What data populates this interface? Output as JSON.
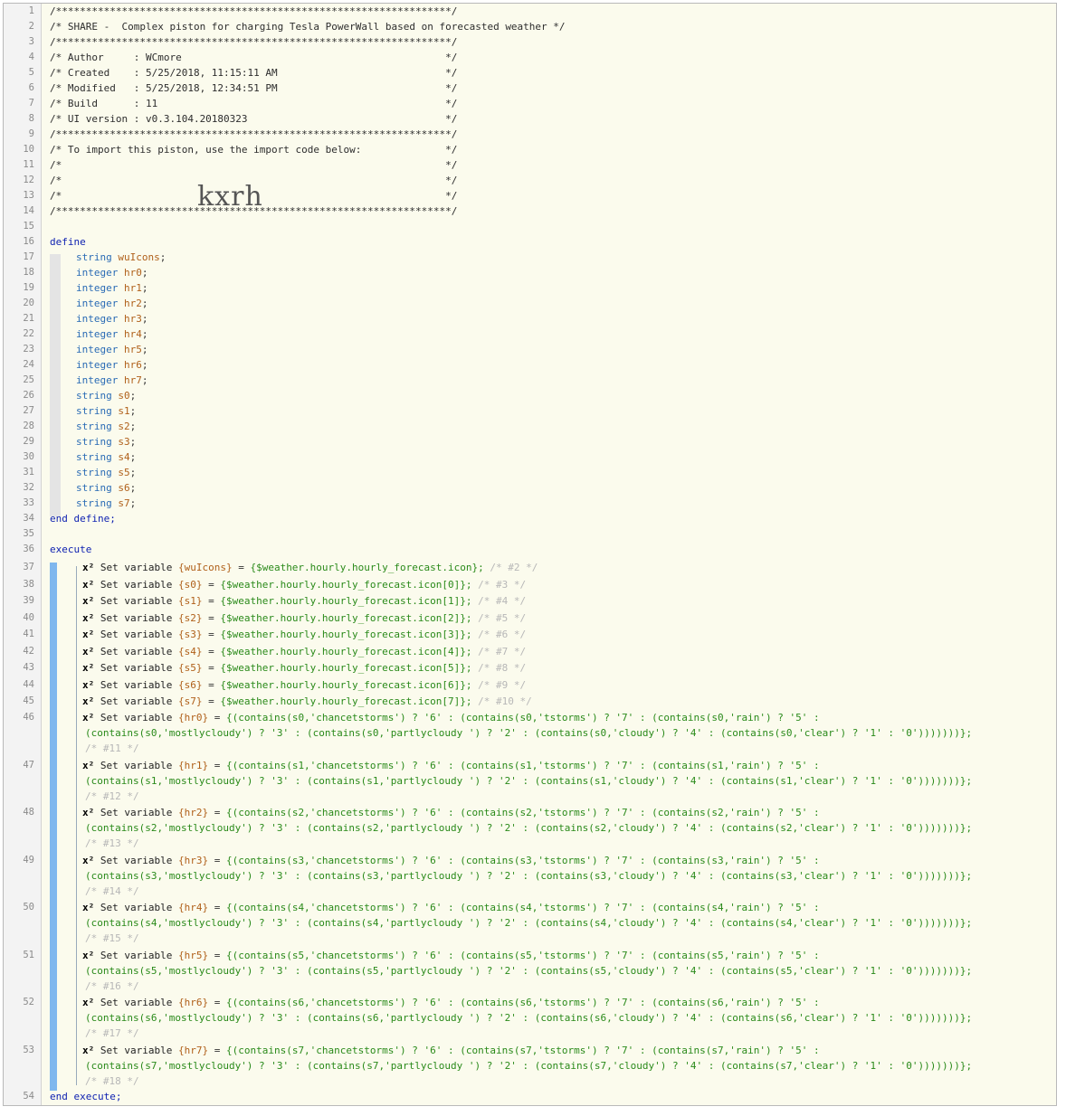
{
  "header": [
    "/******************************************************************/",
    "/* SHARE -  Complex piston for charging Tesla PowerWall based on forecasted weather */",
    "/******************************************************************/",
    "/* Author     : WCmore                                            */",
    "/* Created    : 5/25/2018, 11:15:11 AM                            */",
    "/* Modified   : 5/25/2018, 12:34:51 PM                            */",
    "/* Build      : 11                                                */",
    "/* UI version : v0.3.104.20180323                                 */",
    "/******************************************************************/",
    "/* To import this piston, use the import code below:              */",
    "/*                                                                */",
    "/*                                                                */",
    "/*                                                                */",
    "/******************************************************************/"
  ],
  "import_code": "kxrh",
  "define_kw": "define",
  "end_define": "end define;",
  "execute_kw": "execute",
  "end_execute": "end execute;",
  "declarations": [
    {
      "type": "string",
      "name": "wuIcons"
    },
    {
      "type": "integer",
      "name": "hr0"
    },
    {
      "type": "integer",
      "name": "hr1"
    },
    {
      "type": "integer",
      "name": "hr2"
    },
    {
      "type": "integer",
      "name": "hr3"
    },
    {
      "type": "integer",
      "name": "hr4"
    },
    {
      "type": "integer",
      "name": "hr5"
    },
    {
      "type": "integer",
      "name": "hr6"
    },
    {
      "type": "integer",
      "name": "hr7"
    },
    {
      "type": "string",
      "name": "s0"
    },
    {
      "type": "string",
      "name": "s1"
    },
    {
      "type": "string",
      "name": "s2"
    },
    {
      "type": "string",
      "name": "s3"
    },
    {
      "type": "string",
      "name": "s4"
    },
    {
      "type": "string",
      "name": "s5"
    },
    {
      "type": "string",
      "name": "s6"
    },
    {
      "type": "string",
      "name": "s7"
    }
  ],
  "set_prefix": "x² Set variable",
  "simple_sets": [
    {
      "var": "{wuIcons}",
      "expr": "{$weather.hourly.hourly_forecast.icon};",
      "num": "/* #2 */"
    },
    {
      "var": "{s0}",
      "expr": "{$weather.hourly.hourly_forecast.icon[0]};",
      "num": "/* #3 */"
    },
    {
      "var": "{s1}",
      "expr": "{$weather.hourly.hourly_forecast.icon[1]};",
      "num": "/* #4 */"
    },
    {
      "var": "{s2}",
      "expr": "{$weather.hourly.hourly_forecast.icon[2]};",
      "num": "/* #5 */"
    },
    {
      "var": "{s3}",
      "expr": "{$weather.hourly.hourly_forecast.icon[3]};",
      "num": "/* #6 */"
    },
    {
      "var": "{s4}",
      "expr": "{$weather.hourly.hourly_forecast.icon[4]};",
      "num": "/* #7 */"
    },
    {
      "var": "{s5}",
      "expr": "{$weather.hourly.hourly_forecast.icon[5]};",
      "num": "/* #8 */"
    },
    {
      "var": "{s6}",
      "expr": "{$weather.hourly.hourly_forecast.icon[6]};",
      "num": "/* #9 */"
    },
    {
      "var": "{s7}",
      "expr": "{$weather.hourly.hourly_forecast.icon[7]};",
      "num": "/* #10 */"
    }
  ],
  "complex_sets": [
    {
      "var": "{hr0}",
      "line1": "{(contains(s0,'chancetstorms') ? '6' : (contains(s0,'tstorms') ? '7' : (contains(s0,'rain') ? '5' :",
      "line2": "(contains(s0,'mostlycloudy') ? '3' : (contains(s0,'partlycloudy ') ? '2' : (contains(s0,'cloudy') ? '4' : (contains(s0,'clear') ? '1' : '0')))))))};",
      "num": "/* #11 */"
    },
    {
      "var": "{hr1}",
      "line1": "{(contains(s1,'chancetstorms') ? '6' : (contains(s1,'tstorms') ? '7' : (contains(s1,'rain') ? '5' :",
      "line2": "(contains(s1,'mostlycloudy') ? '3' : (contains(s1,'partlycloudy ') ? '2' : (contains(s1,'cloudy') ? '4' : (contains(s1,'clear') ? '1' : '0')))))))};",
      "num": "/* #12 */"
    },
    {
      "var": "{hr2}",
      "line1": "{(contains(s2,'chancetstorms') ? '6' : (contains(s2,'tstorms') ? '7' : (contains(s2,'rain') ? '5' :",
      "line2": "(contains(s2,'mostlycloudy') ? '3' : (contains(s2,'partlycloudy ') ? '2' : (contains(s2,'cloudy') ? '4' : (contains(s2,'clear') ? '1' : '0')))))))};",
      "num": "/* #13 */"
    },
    {
      "var": "{hr3}",
      "line1": "{(contains(s3,'chancetstorms') ? '6' : (contains(s3,'tstorms') ? '7' : (contains(s3,'rain') ? '5' :",
      "line2": "(contains(s3,'mostlycloudy') ? '3' : (contains(s3,'partlycloudy ') ? '2' : (contains(s3,'cloudy') ? '4' : (contains(s3,'clear') ? '1' : '0')))))))};",
      "num": "/* #14 */"
    },
    {
      "var": "{hr4}",
      "line1": "{(contains(s4,'chancetstorms') ? '6' : (contains(s4,'tstorms') ? '7' : (contains(s4,'rain') ? '5' :",
      "line2": "(contains(s4,'mostlycloudy') ? '3' : (contains(s4,'partlycloudy ') ? '2' : (contains(s4,'cloudy') ? '4' : (contains(s4,'clear') ? '1' : '0')))))))};",
      "num": "/* #15 */"
    },
    {
      "var": "{hr5}",
      "line1": "{(contains(s5,'chancetstorms') ? '6' : (contains(s5,'tstorms') ? '7' : (contains(s5,'rain') ? '5' :",
      "line2": "(contains(s5,'mostlycloudy') ? '3' : (contains(s5,'partlycloudy ') ? '2' : (contains(s5,'cloudy') ? '4' : (contains(s5,'clear') ? '1' : '0')))))))};",
      "num": "/* #16 */"
    },
    {
      "var": "{hr6}",
      "line1": "{(contains(s6,'chancetstorms') ? '6' : (contains(s6,'tstorms') ? '7' : (contains(s6,'rain') ? '5' :",
      "line2": "(contains(s6,'mostlycloudy') ? '3' : (contains(s6,'partlycloudy ') ? '2' : (contains(s6,'cloudy') ? '4' : (contains(s6,'clear') ? '1' : '0')))))))};",
      "num": "/* #17 */"
    },
    {
      "var": "{hr7}",
      "line1": "{(contains(s7,'chancetstorms') ? '6' : (contains(s7,'tstorms') ? '7' : (contains(s7,'rain') ? '5' :",
      "line2": "(contains(s7,'mostlycloudy') ? '3' : (contains(s7,'partlycloudy ') ? '2' : (contains(s7,'cloudy') ? '4' : (contains(s7,'clear') ? '1' : '0')))))))};",
      "num": "/* #18 */"
    }
  ],
  "line_numbers": [
    "1",
    "2",
    "3",
    "4",
    "5",
    "6",
    "7",
    "8",
    "9",
    "10",
    "11",
    "12",
    "13",
    "14",
    "15",
    "16",
    "17",
    "18",
    "19",
    "20",
    "21",
    "22",
    "23",
    "24",
    "25",
    "26",
    "27",
    "28",
    "29",
    "30",
    "31",
    "32",
    "33",
    "34",
    "35",
    "36",
    "37",
    "38",
    "39",
    "40",
    "41",
    "42",
    "43",
    "44",
    "45",
    "46",
    "47",
    "48",
    "49",
    "50",
    "51",
    "52",
    "53",
    "54"
  ],
  "colors": {
    "keyword": "#0c1fb0",
    "type": "#2a6bb5",
    "variable": "#b0601a",
    "string": "#2a8a1a",
    "background": "#fbfbed",
    "gutter": "#f3f3f3",
    "execute_bar": "#7fb7ee"
  }
}
